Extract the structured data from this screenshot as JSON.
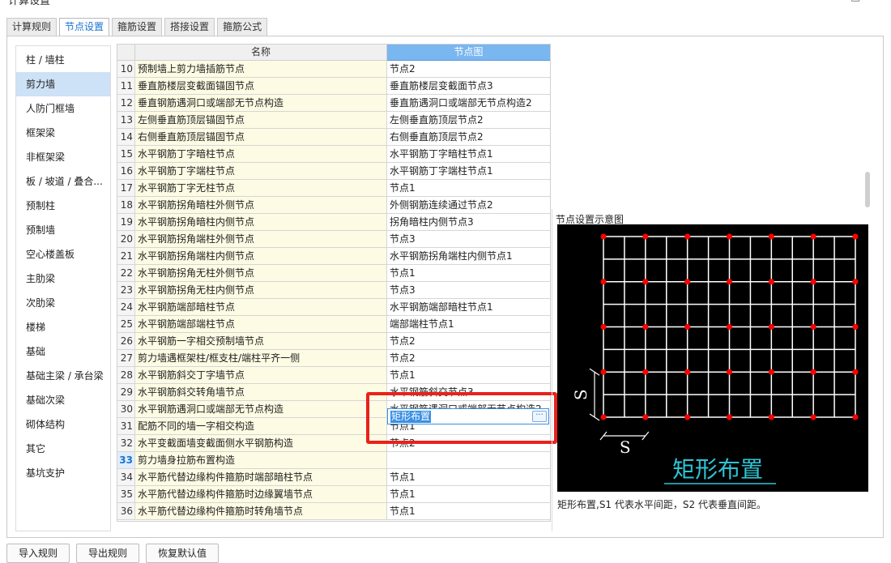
{
  "window": {
    "title": "计算设置"
  },
  "tabs": [
    "计算规则",
    "节点设置",
    "箍筋设置",
    "搭接设置",
    "箍筋公式"
  ],
  "active_tab": 1,
  "sidebar": {
    "items": [
      "柱 / 墙柱",
      "剪力墙",
      "人防门框墙",
      "框架梁",
      "非框架梁",
      "板 / 坡道 / 叠合...",
      "预制柱",
      "预制墙",
      "空心楼盖板",
      "主肋梁",
      "次肋梁",
      "楼梯",
      "基础",
      "基础主梁 / 承台梁",
      "基础次梁",
      "砌体结构",
      "其它",
      "基坑支护"
    ],
    "active": 1
  },
  "grid": {
    "col_name": "名称",
    "col_node": "节点图",
    "rows": [
      {
        "num": "10",
        "name": "预制墙上剪力墙插筋节点",
        "node": "节点2"
      },
      {
        "num": "11",
        "name": "垂直筋楼层变截面锚固节点",
        "node": "垂直筋楼层变截面节点3"
      },
      {
        "num": "12",
        "name": "垂直钢筋遇洞口或端部无节点构造",
        "node": "垂直筋遇洞口或端部无节点构造2"
      },
      {
        "num": "13",
        "name": "左侧垂直筋顶层锚固节点",
        "node": "左侧垂直筋顶层节点2"
      },
      {
        "num": "14",
        "name": "右侧垂直筋顶层锚固节点",
        "node": "右侧垂直筋顶层节点2"
      },
      {
        "num": "15",
        "name": "水平钢筋丁字暗柱节点",
        "node": "水平钢筋丁字暗柱节点1"
      },
      {
        "num": "16",
        "name": "水平钢筋丁字端柱节点",
        "node": "水平钢筋丁字端柱节点1"
      },
      {
        "num": "17",
        "name": "水平钢筋丁字无柱节点",
        "node": "节点1"
      },
      {
        "num": "18",
        "name": "水平钢筋拐角暗柱外侧节点",
        "node": "外侧钢筋连续通过节点2"
      },
      {
        "num": "19",
        "name": "水平钢筋拐角暗柱内侧节点",
        "node": "拐角暗柱内侧节点3"
      },
      {
        "num": "20",
        "name": "水平钢筋拐角端柱外侧节点",
        "node": "节点3"
      },
      {
        "num": "21",
        "name": "水平钢筋拐角端柱内侧节点",
        "node": "水平钢筋拐角端柱内侧节点1"
      },
      {
        "num": "22",
        "name": "水平钢筋拐角无柱外侧节点",
        "node": "节点1"
      },
      {
        "num": "23",
        "name": "水平钢筋拐角无柱内侧节点",
        "node": "节点3"
      },
      {
        "num": "24",
        "name": "水平钢筋端部暗柱节点",
        "node": "水平钢筋端部暗柱节点1"
      },
      {
        "num": "25",
        "name": "水平钢筋端部端柱节点",
        "node": "端部端柱节点1"
      },
      {
        "num": "26",
        "name": "水平钢筋一字相交预制墙节点",
        "node": "节点2"
      },
      {
        "num": "27",
        "name": "剪力墙遇框架柱/框支柱/端柱平齐一侧",
        "node": "节点2"
      },
      {
        "num": "28",
        "name": "水平钢筋斜交丁字墙节点",
        "node": "节点1"
      },
      {
        "num": "29",
        "name": "水平钢筋斜交转角墙节点",
        "node": "水平钢筋斜交节点3"
      },
      {
        "num": "30",
        "name": "水平钢筋遇洞口或端部无节点构造",
        "node": "水平钢筋遇洞口或端部无节点构造2"
      },
      {
        "num": "31",
        "name": "配筋不同的墙一字相交构造",
        "node": "节点1"
      },
      {
        "num": "32",
        "name": "水平变截面墙变截面侧水平钢筋构造",
        "node": "节点2"
      },
      {
        "num": "33",
        "name": "剪力墙身拉筋布置构造",
        "node": "矩形布置"
      },
      {
        "num": "34",
        "name": "水平筋代替边缘构件箍筋时端部暗柱节点",
        "node": "节点1"
      },
      {
        "num": "35",
        "name": "水平筋代替边缘构件箍筋时边缘翼墙节点",
        "node": "节点1"
      },
      {
        "num": "36",
        "name": "水平筋代替边缘构件箍筋时转角墙节点",
        "node": "节点1"
      }
    ],
    "selected_row": 23,
    "editor_dots": "···"
  },
  "preview": {
    "label": "节点设置示意图",
    "drawing_caption": "矩形布置",
    "s_label": "S",
    "description": "矩形布置,S1 代表水平间距，S2 代表垂直间距。",
    "colors": {
      "bg": "#000000",
      "grid": "#ffffff",
      "dot": "#ff0000",
      "caption": "#2ec4d6"
    }
  },
  "buttons": [
    "导入规则",
    "导出规则",
    "恢复默认值"
  ]
}
